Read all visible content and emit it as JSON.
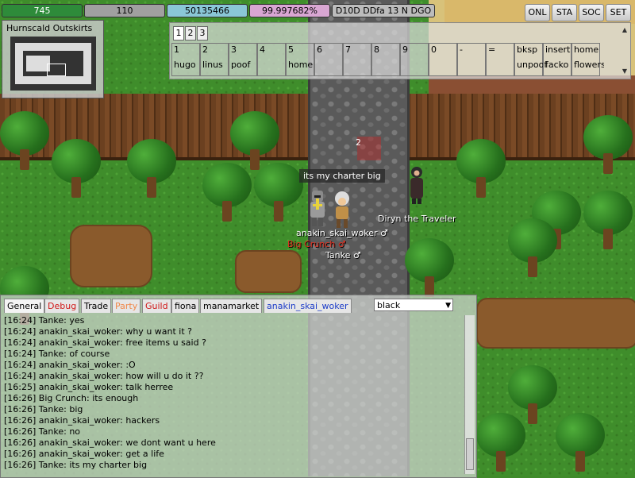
{
  "status_bars": {
    "hp": {
      "value": "745",
      "color": "#2e8b3a"
    },
    "mp": {
      "value": "110",
      "color": "#a0a0a0"
    },
    "xp": {
      "value": "50135466",
      "color": "#8ac7d6"
    },
    "job": {
      "value": "99.997682%",
      "color": "#d9a6d3"
    },
    "money": {
      "value": "D10D DDfa 13 N DGO",
      "color": "#bcbcbc"
    }
  },
  "top_buttons": [
    "ONL",
    "STA",
    "SOC",
    "SET"
  ],
  "minimap": {
    "title": "Hurnscald Outskirts"
  },
  "shortcuts": {
    "tabs": [
      "1",
      "2",
      "3"
    ],
    "slots": [
      {
        "key": "1",
        "label": "hugo"
      },
      {
        "key": "2",
        "label": "linus"
      },
      {
        "key": "3",
        "label": "poof"
      },
      {
        "key": "4",
        "label": ""
      },
      {
        "key": "5",
        "label": "home"
      },
      {
        "key": "6",
        "label": ""
      },
      {
        "key": "7",
        "label": ""
      },
      {
        "key": "8",
        "label": ""
      },
      {
        "key": "9",
        "label": ""
      },
      {
        "key": "0",
        "label": ""
      },
      {
        "key": "-",
        "label": ""
      },
      {
        "key": "=",
        "label": ""
      },
      {
        "key": "bksp",
        "label": "unpoof"
      },
      {
        "key": "insert",
        "label": "facko"
      },
      {
        "key": "home",
        "label": "flowers"
      }
    ]
  },
  "world": {
    "speech": "its my charter big",
    "target_number": "2",
    "npc_name": "Diryn the Traveler",
    "player_name": "anakin_skai_woker ♂",
    "other1_name": "Big Crunch ♂",
    "other2_name": "Tanke ♂"
  },
  "chat": {
    "tabs": [
      {
        "label": "General",
        "color": "#000000"
      },
      {
        "label": "Debug",
        "color": "#d01818"
      },
      {
        "label": "Trade",
        "color": "#000000"
      },
      {
        "label": "Party",
        "color": "#f0884a"
      },
      {
        "label": "Guild",
        "color": "#d01818"
      },
      {
        "label": "fiona",
        "color": "#000000"
      },
      {
        "label": "manamarket",
        "color": "#000000"
      },
      {
        "label": "anakin_skai_woker",
        "color": "#1c3cc8"
      }
    ],
    "color_select": "black",
    "lines": [
      "[16:24] Tanke: yes",
      "[16:24] anakin_skai_woker: why u want it ?",
      "[16:24] anakin_skai_woker: free items u said ?",
      "[16:24] Tanke: of course",
      "[16:24] anakin_skai_woker: :O",
      "[16:24] anakin_skai_woker: how will u do it ??",
      "[16:25] anakin_skai_woker: talk herree",
      "[16:26] Big Crunch: its enough",
      "[16:26] Tanke: big",
      "[16:26] anakin_skai_woker: hackers",
      "[16:26] Tanke: no",
      "[16:26] anakin_skai_woker: we dont want u here",
      "[16:26] anakin_skai_woker: get a life",
      "[16:26] Tanke: its my charter big"
    ]
  }
}
